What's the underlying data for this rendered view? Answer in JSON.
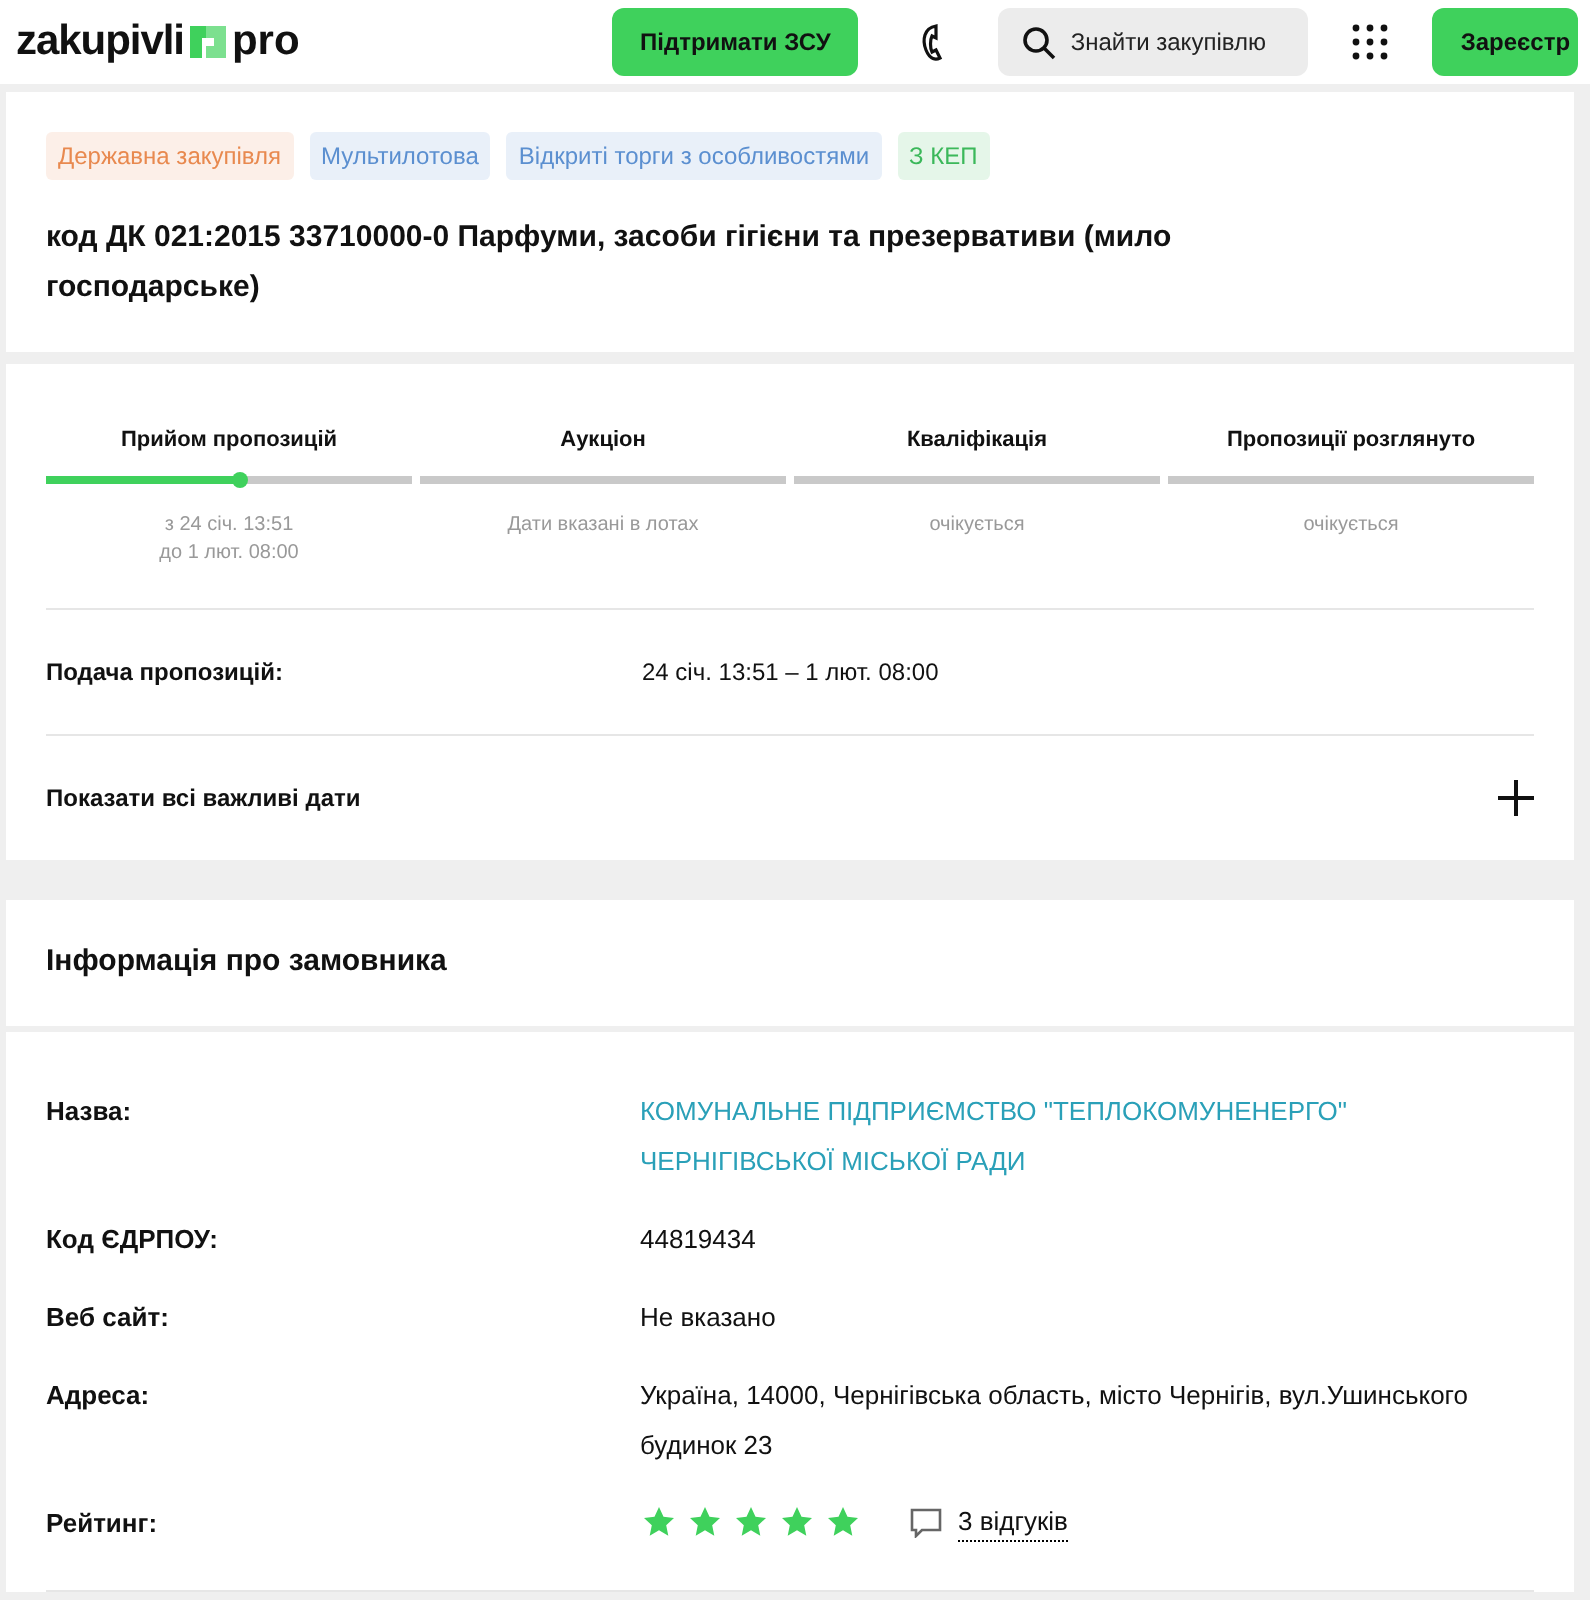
{
  "header": {
    "logo_left": "zakupivli",
    "logo_right": "pro",
    "support_button": "Підтримати ЗСУ",
    "search": {
      "placeholder": "Знайти закупівлю"
    },
    "register_button": "Зареєстр"
  },
  "tags": [
    {
      "label": "Державна закупівля",
      "color": "#e8894f"
    },
    {
      "label": "Мультилотова",
      "color": "#5b8fd0"
    },
    {
      "label": "Відкриті торги з особливостями",
      "color": "#5b8fd0"
    },
    {
      "label": "З КЕП",
      "color": "#3bb85a"
    }
  ],
  "title": "код ДК 021:2015 33710000-0 Парфуми, засоби гігієни та презервативи (мило господарське)",
  "stages": [
    {
      "name": "Прийом пропозицій",
      "level": 0.53,
      "notes": [
        "з 24 січ. 13:51",
        "до 1 лют. 08:00"
      ]
    },
    {
      "name": "Аукціон",
      "notes": [
        "Дати вказані в лотах"
      ]
    },
    {
      "name": "Кваліфікація",
      "notes": [
        "очікується"
      ]
    },
    {
      "name": "Пропозиції розглянуто",
      "notes": [
        "очікується"
      ]
    }
  ],
  "submission": {
    "label": "Подача пропозицій:",
    "value": "24 січ. 13:51 – 1 лют. 08:00"
  },
  "show_dates": {
    "label": "Показати всі важливі дати",
    "expanded": false
  },
  "customer": {
    "heading": "Інформація про замовника",
    "rows": [
      {
        "kind": "link",
        "label": "Назва:",
        "value": "КОМУНАЛЬНЕ ПІДПРИЄМСТВО \"ТЕПЛОКОМУНЕНЕРГО\" ЧЕРНІГІВСЬКОЇ МІСЬКОЇ РАДИ"
      },
      {
        "kind": "text",
        "label": "Код ЄДРПОУ:",
        "value": "44819434"
      },
      {
        "kind": "text",
        "label": "Веб сайт:",
        "value": "Не вказано"
      },
      {
        "kind": "text",
        "label": "Адреса:",
        "value": "Україна, 14000, Чернігівська область, місто Чернігів, вул.Ушинського будинок 23"
      },
      {
        "kind": "rating",
        "label": "Рейтинг:",
        "stars": 5,
        "reviews": "3 відгуків"
      }
    ]
  }
}
